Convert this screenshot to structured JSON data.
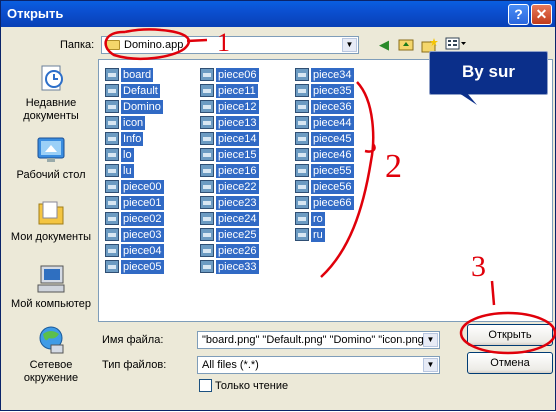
{
  "window": {
    "title": "Открыть",
    "help_glyph": "?",
    "close_glyph": "✕"
  },
  "folder": {
    "label": "Папка:",
    "value": "Domino.app",
    "icon": "folder-icon"
  },
  "toolbar": {
    "icons": [
      "back-icon",
      "up-folder-icon",
      "new-folder-icon",
      "view-menu-icon"
    ]
  },
  "callout": {
    "text": "By sur"
  },
  "places": [
    {
      "label": "Недавние документы",
      "icon": "recent-documents-icon"
    },
    {
      "label": "Рабочий стол",
      "icon": "desktop-icon"
    },
    {
      "label": "Мои документы",
      "icon": "my-documents-icon"
    },
    {
      "label": "Мой компьютер",
      "icon": "my-computer-icon"
    },
    {
      "label": "Сетевое окружение",
      "icon": "network-icon"
    }
  ],
  "files": {
    "column1": [
      "board",
      "Default",
      "Domino",
      "icon",
      "Info",
      "lo",
      "lu",
      "piece00",
      "piece01",
      "piece02",
      "piece03",
      "piece04",
      "piece05"
    ],
    "column2": [
      "piece06",
      "piece11",
      "piece12",
      "piece13",
      "piece14",
      "piece15",
      "piece16",
      "piece22",
      "piece23",
      "piece24",
      "piece25",
      "piece26",
      "piece33"
    ],
    "column3": [
      "piece34",
      "piece35",
      "piece36",
      "piece44",
      "piece45",
      "piece46",
      "piece55",
      "piece56",
      "piece66",
      "ro",
      "ru"
    ]
  },
  "filename": {
    "label": "Имя файла:",
    "value": "\"board.png\" \"Default.png\" \"Domino\" \"icon.png"
  },
  "filetype": {
    "label": "Тип файлов:",
    "value": "All files (*.*)"
  },
  "readonly": {
    "label": "Только чтение",
    "checked": false
  },
  "buttons": {
    "open": "Открыть",
    "cancel": "Отмена"
  },
  "annotations": [
    "1",
    "2",
    "3"
  ],
  "colors": {
    "title_bar": "#0a5fe0",
    "selection": "#316ac5",
    "callout": "#0b2f8a",
    "ink": "#e0000a"
  }
}
